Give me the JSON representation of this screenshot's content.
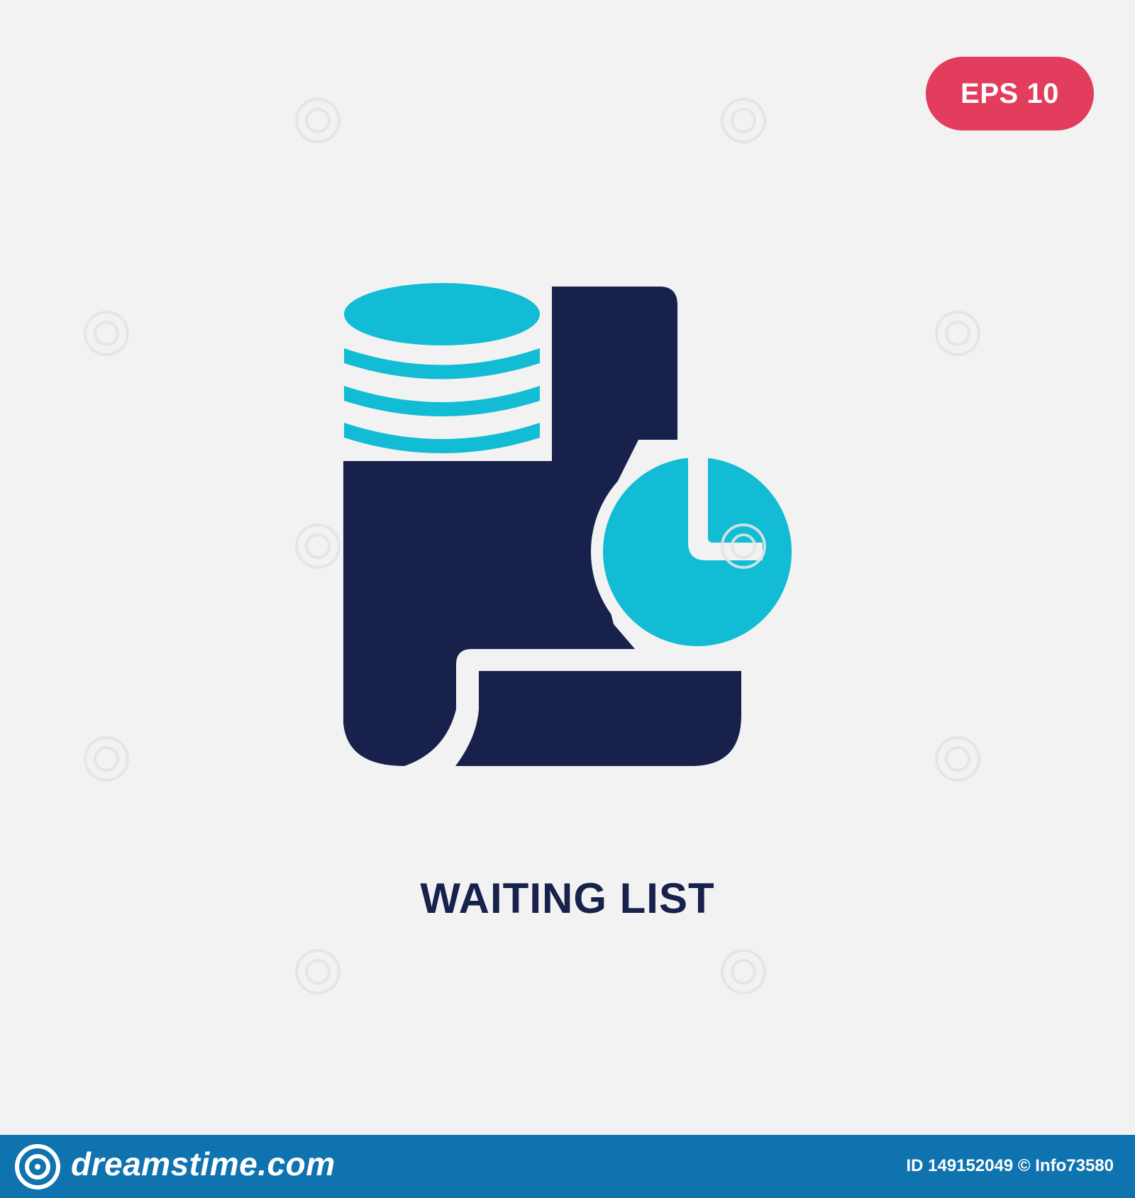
{
  "badge": {
    "label": "EPS 10"
  },
  "title": "WAITING LIST",
  "footer": {
    "brand": "dreamstime.com",
    "id_text": "ID 149152049 © Info73580"
  },
  "colors": {
    "background": "#f2f2f2",
    "navy": "#17214b",
    "cyan": "#12bcd4",
    "badge": "#e23d5c",
    "footer": "#0e73ae"
  },
  "icons": {
    "main": "database-document-clock-icon",
    "footer_logo": "dreamstime-logo-icon"
  }
}
